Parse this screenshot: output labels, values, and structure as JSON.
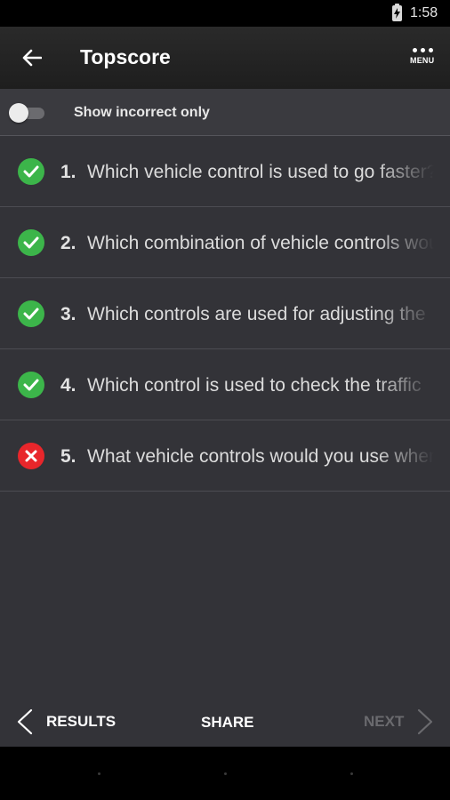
{
  "status_bar": {
    "time": "1:58",
    "battery_icon": "battery-charging-icon"
  },
  "toolbar": {
    "back_icon": "arrow-left-icon",
    "title": "Topscore",
    "menu_icon": "more-dots-icon",
    "menu_label": "MENU"
  },
  "filter": {
    "label": "Show incorrect only",
    "toggle_on": false
  },
  "questions": [
    {
      "number": "1.",
      "text": "Which vehicle control is used to go faster?",
      "result": "correct"
    },
    {
      "number": "2.",
      "text": "Which combination of vehicle controls would you use",
      "result": "correct"
    },
    {
      "number": "3.",
      "text": "Which controls are used for adjusting the",
      "result": "correct"
    },
    {
      "number": "4.",
      "text": "Which control is used to check the traffic",
      "result": "correct"
    },
    {
      "number": "5.",
      "text": "What vehicle controls would you use when",
      "result": "incorrect"
    }
  ],
  "bottom_bar": {
    "results_label": "RESULTS",
    "share_label": "SHARE",
    "next_label": "NEXT"
  },
  "colors": {
    "correct": "#3cb54a",
    "incorrect": "#e8262b",
    "background": "#333338",
    "toolbar": "#222222",
    "disabled_text": "#6a6a6e"
  }
}
